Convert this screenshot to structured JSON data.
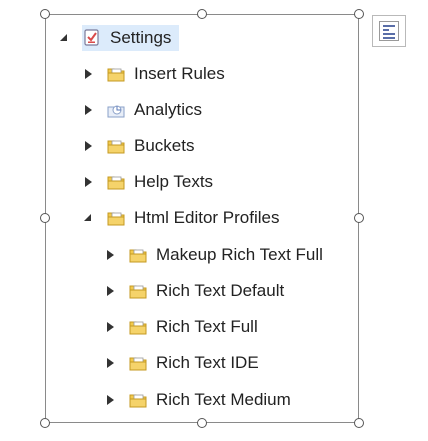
{
  "tree": {
    "root": {
      "label": "Settings",
      "state": "expanded",
      "selected": true
    },
    "children": [
      {
        "label": "Insert Rules",
        "state": "collapsed",
        "icon": "folder-icon"
      },
      {
        "label": "Analytics",
        "state": "collapsed",
        "icon": "analytics-folder-icon"
      },
      {
        "label": "Buckets",
        "state": "collapsed",
        "icon": "folder-icon"
      },
      {
        "label": "Help Texts",
        "state": "collapsed",
        "icon": "folder-icon"
      },
      {
        "label": "Html Editor Profiles",
        "state": "expanded",
        "icon": "folder-icon"
      }
    ],
    "profiles": [
      {
        "label": "Makeup Rich Text Full",
        "state": "collapsed",
        "icon": "folder-icon"
      },
      {
        "label": "Rich Text Default",
        "state": "collapsed",
        "icon": "folder-icon"
      },
      {
        "label": "Rich Text Full",
        "state": "collapsed",
        "icon": "folder-icon"
      },
      {
        "label": "Rich Text IDE",
        "state": "collapsed",
        "icon": "folder-icon"
      },
      {
        "label": "Rich Text Medium",
        "state": "collapsed",
        "icon": "folder-icon"
      }
    ]
  },
  "colors": {
    "selection_bg": "#dcebfb",
    "folder": "#f2c94c",
    "settings_icon": "#d94a4a"
  },
  "layout_options_icon": "layout-options-icon"
}
